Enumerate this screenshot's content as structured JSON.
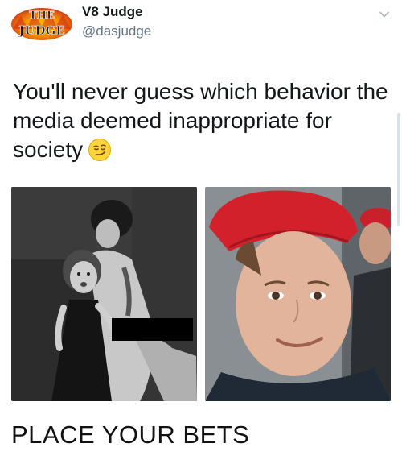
{
  "author": {
    "avatar_text_top": "THE",
    "avatar_text_bottom": "JUDGE",
    "display_name": "V8 Judge",
    "handle": "@dasjudge"
  },
  "menu": {
    "icon": "chevron-down-icon"
  },
  "tweet": {
    "text": "You'll never guess which behavior the media deemed inappropriate for society",
    "emoji": "smirking-face-emoji"
  },
  "media": {
    "left_photo": "black-and-white-photo-girl-with-performer-censored",
    "right_photo": "color-photo-smiling-young-man-red-cap"
  },
  "caption": "PLACE YOUR BETS",
  "colors": {
    "text": "#14171a",
    "handle": "#657786",
    "cap_red": "#d3212c",
    "avatar_red": "#d02a1e",
    "avatar_yellow": "#f2b705"
  }
}
